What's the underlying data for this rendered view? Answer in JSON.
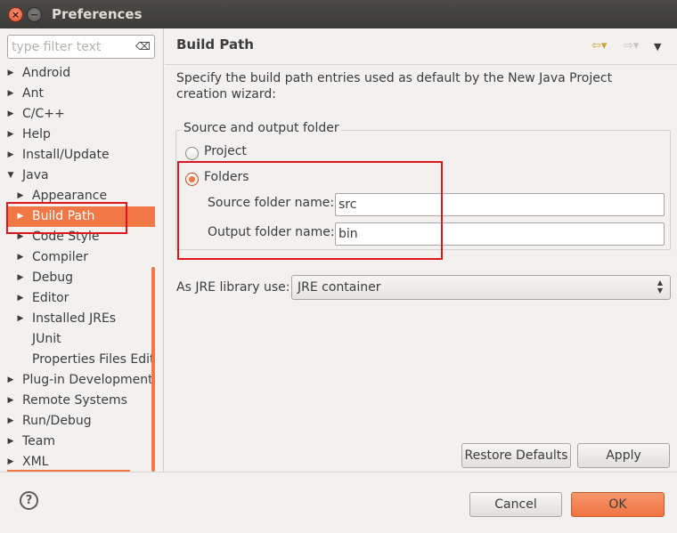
{
  "window": {
    "title": "Preferences",
    "close_glyph": "×",
    "min_glyph": "−"
  },
  "filter": {
    "placeholder": "type filter text",
    "clear_glyph": "⌫"
  },
  "tree": {
    "items": [
      {
        "label": "Android",
        "arrow": "▶"
      },
      {
        "label": "Ant",
        "arrow": "▶"
      },
      {
        "label": "C/C++",
        "arrow": "▶"
      },
      {
        "label": "Help",
        "arrow": "▶"
      },
      {
        "label": "Install/Update",
        "arrow": "▶"
      },
      {
        "label": "Java",
        "arrow": "▼"
      },
      {
        "label": "Appearance",
        "arrow": "▶"
      },
      {
        "label": "Build Path",
        "arrow": "▶"
      },
      {
        "label": "Code Style",
        "arrow": "▶"
      },
      {
        "label": "Compiler",
        "arrow": "▶"
      },
      {
        "label": "Debug",
        "arrow": "▶"
      },
      {
        "label": "Editor",
        "arrow": "▶"
      },
      {
        "label": "Installed JREs",
        "arrow": "▶"
      },
      {
        "label": "JUnit",
        "arrow": ""
      },
      {
        "label": "Properties Files Edit",
        "arrow": ""
      },
      {
        "label": "Plug-in Development",
        "arrow": "▶"
      },
      {
        "label": "Remote Systems",
        "arrow": "▶"
      },
      {
        "label": "Run/Debug",
        "arrow": "▶"
      },
      {
        "label": "Team",
        "arrow": "▶"
      },
      {
        "label": "XML",
        "arrow": "▶"
      }
    ]
  },
  "page": {
    "title": "Build Path",
    "nav_back": "⇦▾",
    "nav_forward": "⇨▾",
    "nav_menu": "▼",
    "description": "Specify the build path entries used as default by the New Java Project creation wizard:",
    "group": {
      "title": "Source and output folder",
      "project_label": "Project",
      "folders_label": "Folders",
      "source_label": "Source folder name:",
      "source_value": "src",
      "output_label": "Output folder name:",
      "output_value": "bin"
    },
    "jre": {
      "label": "As JRE library use:",
      "value": "JRE container",
      "spin_up": "▲",
      "spin_down": "▼"
    },
    "restore_defaults": "Restore Defaults",
    "apply": "Apply"
  },
  "footer": {
    "help": "?",
    "cancel": "Cancel",
    "ok": "OK"
  },
  "colors": {
    "accent": "#f07746",
    "highlight": "#e0141e"
  }
}
